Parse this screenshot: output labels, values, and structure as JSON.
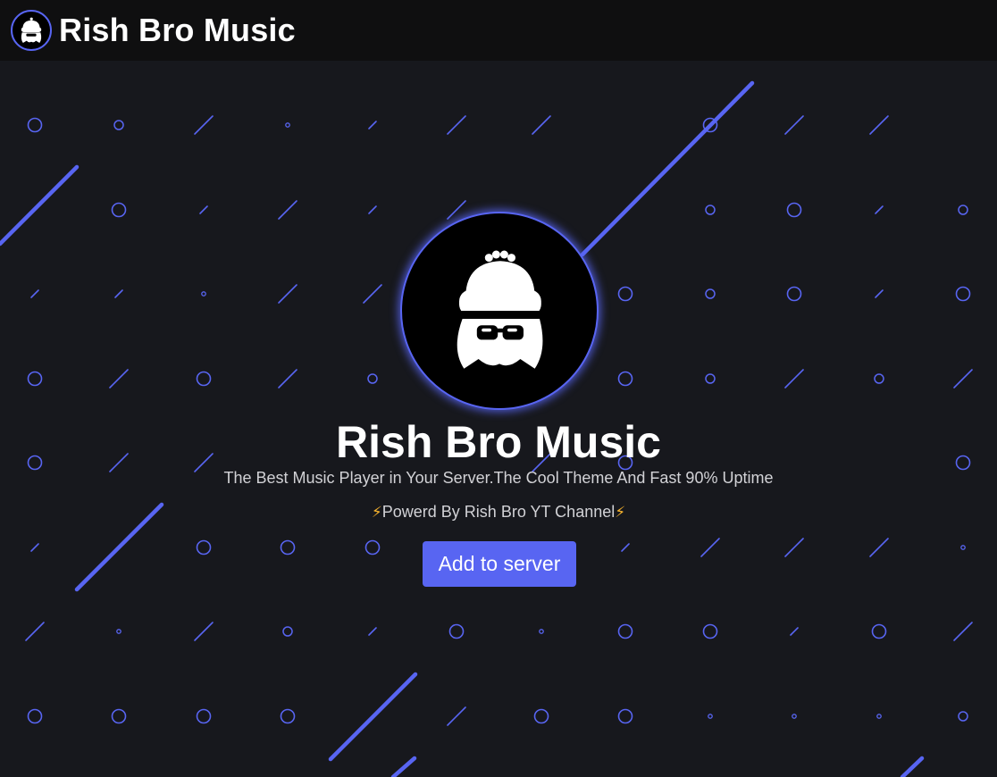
{
  "navbar": {
    "logo_icon": "bot-avatar-icon",
    "title": "Rish Bro Music"
  },
  "hero": {
    "avatar_icon": "bot-avatar-icon",
    "title": "Rish Bro Music",
    "subtitle": "The Best Music Player in Your Server.The Cool Theme And Fast 90% Uptime",
    "powered_prefix": "⚡",
    "powered_text": "Powerd By Rish Bro YT Channel",
    "powered_suffix": "⚡",
    "button_label": "Add to server"
  },
  "colors": {
    "background": "#17181d",
    "navbar": "#0f0f10",
    "accent": "#5865f2",
    "text": "#ffffff",
    "muted_text": "#d2d2d6",
    "bolt": "#f5b22e"
  }
}
